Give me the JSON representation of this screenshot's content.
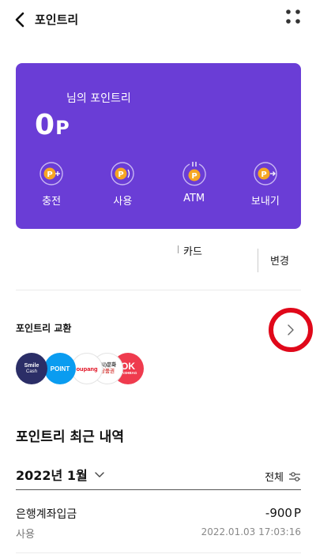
{
  "header": {
    "title": "포인트리",
    "back_icon": "chevron-left-icon",
    "menu_icon": "four-dots-menu-icon"
  },
  "card": {
    "background_color": "#6a3dd6",
    "owner_label": "님의 포인트리",
    "balance": "0",
    "balance_unit": "P",
    "actions": [
      {
        "label": "충전",
        "icon": "point-charge-icon"
      },
      {
        "label": "사용",
        "icon": "point-use-icon"
      },
      {
        "label": "ATM",
        "icon": "point-atm-icon"
      },
      {
        "label": "보내기",
        "icon": "point-send-icon"
      }
    ]
  },
  "linked_card": {
    "label": "카드",
    "change_label": "변경"
  },
  "exchange": {
    "title": "포인트리 교환",
    "partners": [
      {
        "name": "smile-cash",
        "label_line1": "Smile",
        "label_line2": "Cash",
        "color": "#2b2e67"
      },
      {
        "name": "point",
        "label_line1": "POINT",
        "label_line2": "",
        "color": "#0a9cf0"
      },
      {
        "name": "coupang",
        "label_line1": "oupang",
        "label_line2": "",
        "color": "#ffffff"
      },
      {
        "name": "gift-card",
        "label_line1": "(시)문화",
        "label_line2": "상품권",
        "color": "#ffffff"
      },
      {
        "name": "ok-cashbag",
        "label_line1": "OK",
        "label_line2": "CASHBAG",
        "color": "#ef3b4e"
      }
    ],
    "highlight_color": "#e0081a"
  },
  "history": {
    "title": "포인트리 최근 내역",
    "month": "2022년 1월",
    "filter_label": "전체",
    "transactions": [
      {
        "title": "은행계좌입금",
        "amount": "-900",
        "unit": "P",
        "type": "사용",
        "datetime": "2022.01.03 17:03:16"
      }
    ]
  }
}
